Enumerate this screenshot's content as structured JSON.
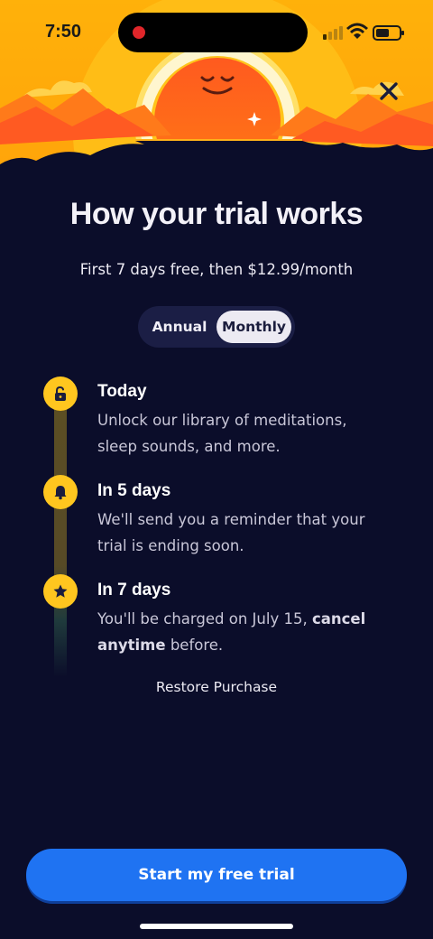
{
  "status_bar": {
    "time": "7:50",
    "icons": [
      "signal-icon",
      "wifi-icon",
      "battery-icon"
    ]
  },
  "hero": {
    "illustration": "sun-character-sunrise-illustration",
    "close_icon": "close-icon"
  },
  "header": {
    "title": "How your trial works",
    "subtitle": "First 7 days free, then $12.99/month"
  },
  "billing_toggle": {
    "options": [
      "Annual",
      "Monthly"
    ],
    "selected": "Monthly"
  },
  "timeline": [
    {
      "icon": "unlock-icon",
      "title": "Today",
      "line1": "Unlock our library of meditations,",
      "line2": "sleep sounds, and more."
    },
    {
      "icon": "bell-icon",
      "title": "In 5 days",
      "line1": "We'll send you a reminder that your",
      "line2": "trial is ending soon."
    },
    {
      "icon": "star-icon",
      "title": "In 7 days",
      "line1_plain": "You'll be charged on July 15, ",
      "line1_bold": "cancel",
      "line2_bold": "anytime",
      "line2_plain": " before."
    }
  ],
  "restore_label": "Restore Purchase",
  "cta_label": "Start my free trial",
  "colors": {
    "background": "#0b0d2a",
    "accent_yellow": "#ffc61f",
    "sun_orange": "#ff6a1c",
    "cta_blue": "#1f73f2",
    "toggle_bg": "#1b1e45",
    "toggle_selected": "#eceaf2"
  }
}
